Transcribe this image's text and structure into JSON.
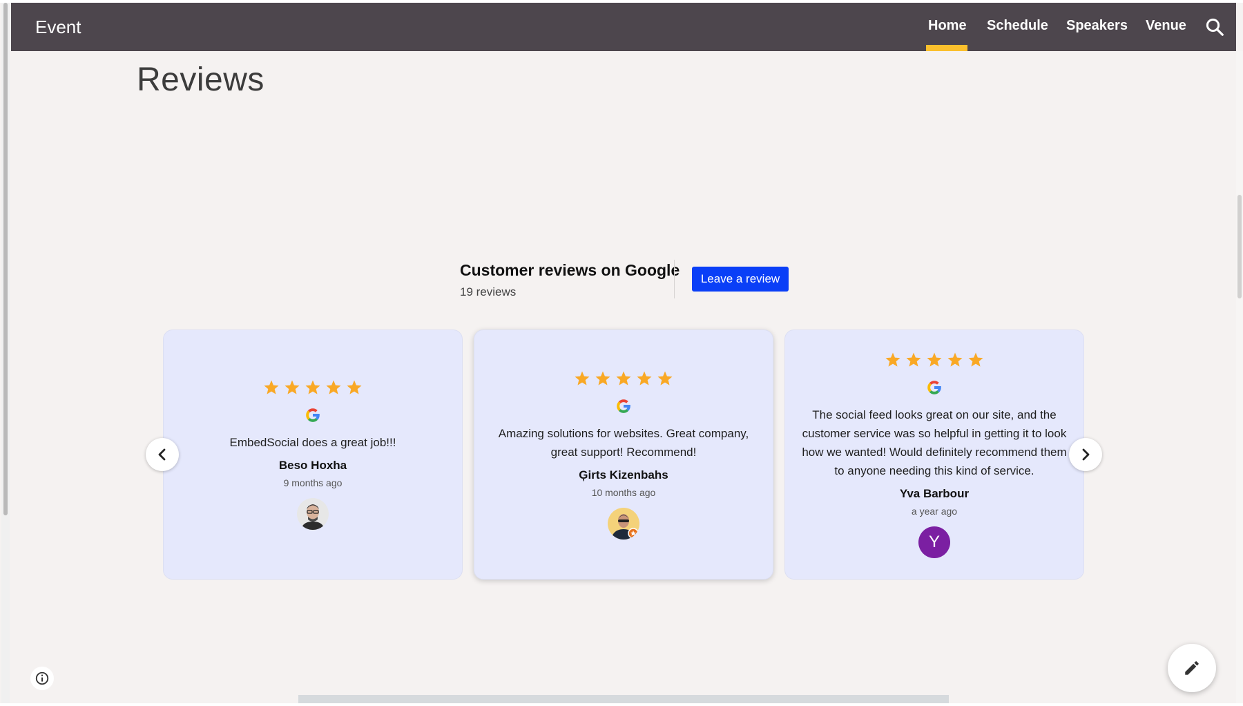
{
  "nav": {
    "brand": "Event",
    "items": [
      {
        "label": "Home",
        "active": true
      },
      {
        "label": "Schedule"
      },
      {
        "label": "Speakers"
      },
      {
        "label": "Venue"
      }
    ],
    "search_icon": "search-icon",
    "accent_color": "#fbc02d",
    "bar_color": "#4d464d"
  },
  "page": {
    "title": "Reviews"
  },
  "widget": {
    "title": "Customer reviews on Google",
    "count": "19 reviews",
    "leave_review_label": "Leave a review",
    "button_color": "#0a3ff7",
    "reviews": [
      {
        "rating": 5,
        "text": "EmbedSocial does a great job!!!",
        "name": "Beso Hoxha",
        "time": "9 months ago",
        "avatar": "photo"
      },
      {
        "rating": 5,
        "text": "Amazing solutions for websites. Great company, great support! Recommend!",
        "name": "Ģirts Kizenbahs",
        "time": "10 months ago",
        "avatar": "photo"
      },
      {
        "rating": 5,
        "text": "The social feed looks great on our site, and the customer service was so helpful in getting it to look how we wanted! Would definitely recommend them to anyone needing this kind of service.",
        "name": "Yva Barbour",
        "time": "a year ago",
        "avatar_letter": "Y",
        "avatar_color": "#7b1fa2"
      }
    ],
    "star_color": "#f9a825",
    "icons": [
      "star-icon",
      "google-logo-icon",
      "chevron-left-icon",
      "chevron-right-icon"
    ]
  },
  "footer": {
    "info_icon": "info-icon",
    "edit_icon": "pencil-icon"
  }
}
